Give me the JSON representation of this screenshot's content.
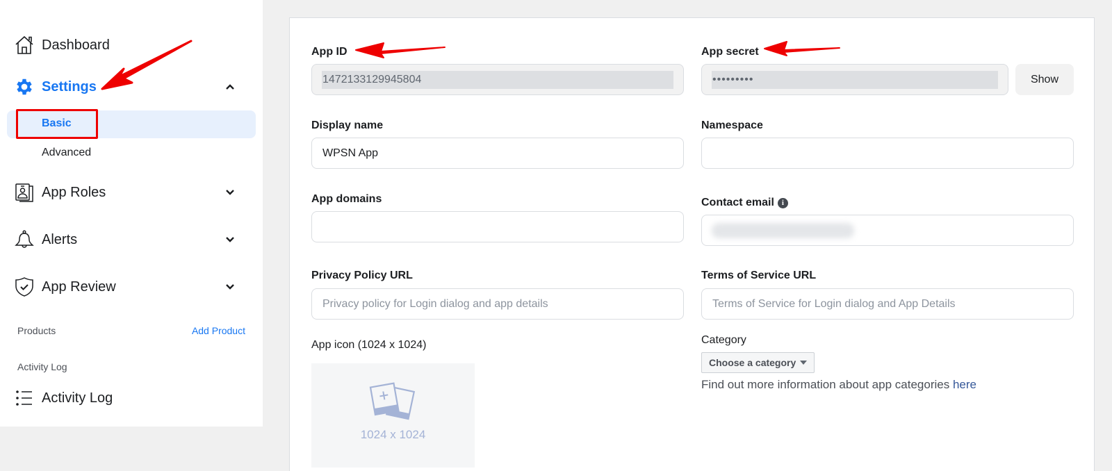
{
  "sidebar": {
    "items": [
      {
        "label": "Dashboard",
        "icon": "home-icon"
      },
      {
        "label": "Settings",
        "icon": "gear-icon",
        "expanded": true,
        "active": true
      },
      {
        "label": "App Roles",
        "icon": "id-badge-icon"
      },
      {
        "label": "Alerts",
        "icon": "bell-icon"
      },
      {
        "label": "App Review",
        "icon": "shield-check-icon"
      }
    ],
    "settings_subitems": [
      {
        "label": "Basic",
        "active": true
      },
      {
        "label": "Advanced"
      }
    ],
    "products_section": {
      "label": "Products",
      "action": "Add Product"
    },
    "activity_section": {
      "label": "Activity Log",
      "item": "Activity Log"
    }
  },
  "form": {
    "app_id": {
      "label": "App ID",
      "value": "1472133129945804"
    },
    "app_secret": {
      "label": "App secret",
      "value": "•••••••••",
      "show_button": "Show"
    },
    "display_name": {
      "label": "Display name",
      "value": "WPSN App"
    },
    "namespace": {
      "label": "Namespace",
      "value": ""
    },
    "app_domains": {
      "label": "App domains",
      "value": ""
    },
    "contact_email": {
      "label": "Contact email",
      "value": "[redacted]"
    },
    "privacy_policy_url": {
      "label": "Privacy Policy URL",
      "placeholder": "Privacy policy for Login dialog and app details"
    },
    "terms_url": {
      "label": "Terms of Service URL",
      "placeholder": "Terms of Service for Login dialog and App Details"
    },
    "app_icon": {
      "label": "App icon (1024 x 1024)",
      "size_text": "1024 x 1024"
    },
    "category": {
      "label": "Category",
      "selected": "Choose a category",
      "help_text": "Find out more information about app categories ",
      "help_link": "here"
    }
  },
  "colors": {
    "accent": "#1877f2",
    "annotation": "#ee0000",
    "active_bg": "#e7f0fd"
  }
}
